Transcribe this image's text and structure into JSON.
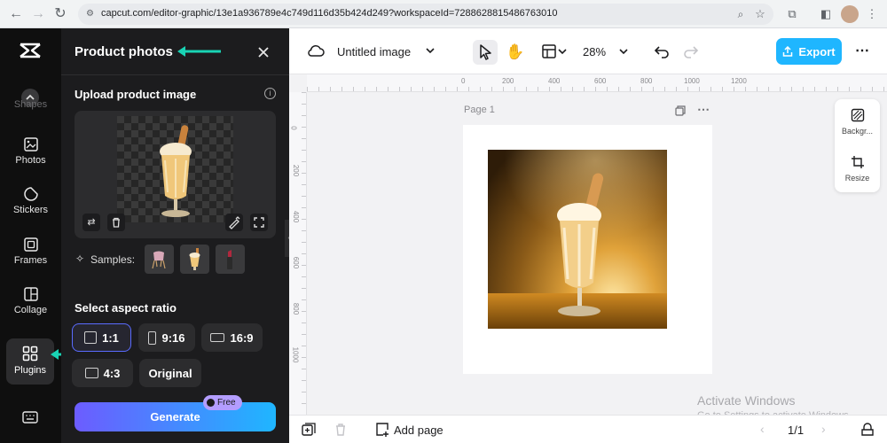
{
  "browser": {
    "url": "capcut.com/editor-graphic/13e1a936789e4c749d116d35b424d249?workspaceId=7288628815486763010"
  },
  "rail": {
    "items": [
      {
        "label": "Shapes"
      },
      {
        "label": "Photos"
      },
      {
        "label": "Stickers"
      },
      {
        "label": "Frames"
      },
      {
        "label": "Collage"
      },
      {
        "label": "Plugins"
      }
    ]
  },
  "panel": {
    "title": "Product photos",
    "upload_label": "Upload product image",
    "samples_label": "Samples:",
    "aspect_label": "Select aspect ratio",
    "ratios": [
      "1:1",
      "9:16",
      "16:9",
      "4:3",
      "Original"
    ],
    "selected_ratio": "1:1",
    "free_badge": "Free",
    "generate_label": "Generate"
  },
  "editor": {
    "doc_title": "Untitled image",
    "zoom": "28%",
    "export_label": "Export",
    "page_label": "Page 1",
    "ruler_top": [
      "0",
      "200",
      "400",
      "600",
      "800",
      "1000",
      "1200"
    ],
    "ruler_left": [
      "0",
      "200",
      "400",
      "600",
      "800",
      "1000"
    ],
    "side_tools": [
      "Backgr...",
      "Resize"
    ],
    "add_page": "Add page",
    "page_counter": "1/1",
    "watermark_title": "Activate Windows",
    "watermark_sub": "Go to Settings to activate Windows."
  },
  "colors": {
    "accent": "#1fb6ff",
    "arrow": "#19d3b4",
    "generate_start": "#6c5cff",
    "generate_end": "#1fb6ff"
  }
}
